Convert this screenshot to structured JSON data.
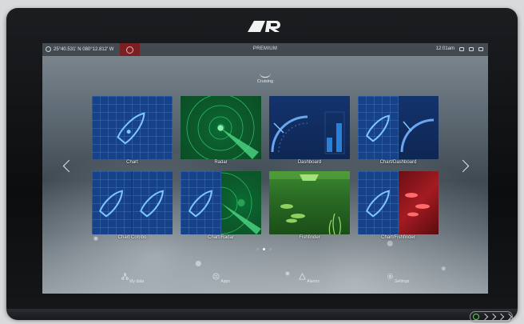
{
  "status_bar": {
    "position": "25°40.531' N  080°12.812' W",
    "title": "PREMIUM",
    "time": "12:01am"
  },
  "mode": {
    "label": "Cruising"
  },
  "tiles": [
    {
      "label": "Chart"
    },
    {
      "label": "Radar"
    },
    {
      "label": "Dashboard"
    },
    {
      "label": "Chart/Dashboard"
    },
    {
      "label": "Chart Combo"
    },
    {
      "label": "Chart/Radar"
    },
    {
      "label": "Fishfinder"
    },
    {
      "label": "Chart/Fishfinder"
    }
  ],
  "pager": {
    "pages": 3,
    "current": 2
  },
  "bottom_nav": [
    {
      "label": "My data",
      "icon": "my-data-icon"
    },
    {
      "label": "Apps",
      "icon": "apps-icon"
    },
    {
      "label": "Alarms",
      "icon": "alarms-icon"
    },
    {
      "label": "Settings",
      "icon": "settings-icon"
    }
  ],
  "colors": {
    "accent": "#2a7fd8",
    "mob_red": "#7a1f22",
    "power_green": "#5fd15a"
  }
}
